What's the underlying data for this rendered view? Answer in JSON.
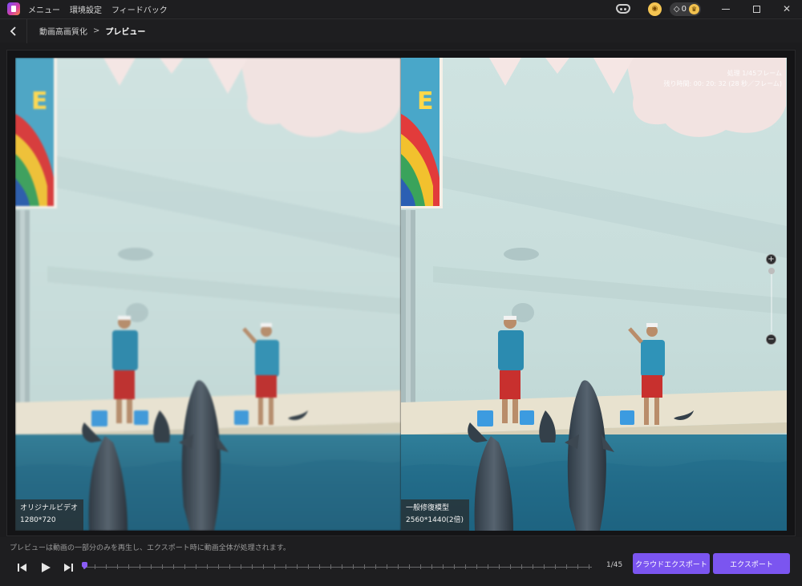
{
  "titlebar": {
    "menu": [
      "メニュー",
      "環境設定",
      "フィードバック"
    ],
    "gem_count": "0",
    "icons": {
      "app": "app-logo-icon",
      "discord": "discord-icon",
      "cart": "cart-icon",
      "gem": "gem-icon",
      "crown": "crown-icon"
    }
  },
  "breadcrumb": {
    "parent": "動画高画質化",
    "separator": ">",
    "current": "プレビュー"
  },
  "preview": {
    "left_label": {
      "name": "オリジナルビデオ",
      "resolution": "1280*720"
    },
    "right_label": {
      "name": "一般修復模型",
      "resolution": "2560*1440(2倍)"
    },
    "frame_info": {
      "line1": "処理 1/45フレーム",
      "line2": "残り時間: 00: 20: 32 (28 秒／フレーム)"
    },
    "zoom": {
      "plus": "+",
      "minus": "−",
      "level": 0
    }
  },
  "bottom": {
    "notice": "プレビューは動画の一部分のみを再生し、エクスポート時に動画全体が処理されます。",
    "page": "1/45",
    "progress": 0.0,
    "cloud_export_label": "クラウドエクスポート",
    "export_label": "エクスポート"
  },
  "colors": {
    "accent": "#7b55f0",
    "background": "#1c1c1e",
    "playhead": "#8b5cf6"
  }
}
